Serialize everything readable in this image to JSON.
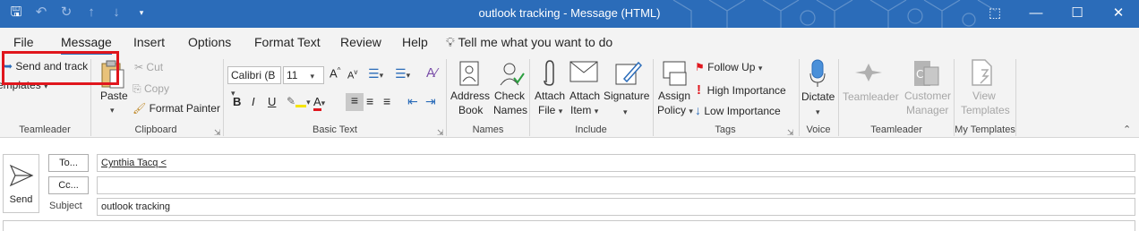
{
  "window": {
    "title": "outlook tracking  -  Message (HTML)",
    "accent": "#2b6cb9"
  },
  "menu": {
    "tabs": [
      "File",
      "Message",
      "Insert",
      "Options",
      "Format Text",
      "Review",
      "Help"
    ],
    "tell_me": "Tell me what you want to do"
  },
  "ribbon": {
    "teamleader": {
      "send_and_track": "Send and track",
      "templates": "Templates",
      "group": "Teamleader"
    },
    "clipboard": {
      "paste": "Paste",
      "cut": "Cut",
      "copy": "Copy",
      "format_painter": "Format Painter",
      "group": "Clipboard"
    },
    "basic_text": {
      "font": "Calibri (B",
      "size": "11",
      "group": "Basic Text"
    },
    "names": {
      "address_book_1": "Address",
      "address_book_2": "Book",
      "check_names_1": "Check",
      "check_names_2": "Names",
      "group": "Names"
    },
    "include": {
      "attach_file_1": "Attach",
      "attach_file_2": "File",
      "attach_item_1": "Attach",
      "attach_item_2": "Item",
      "signature": "Signature",
      "group": "Include"
    },
    "tags": {
      "assign_policy_1": "Assign",
      "assign_policy_2": "Policy",
      "follow_up": "Follow Up",
      "high_importance": "High Importance",
      "low_importance": "Low Importance",
      "group": "Tags"
    },
    "voice": {
      "dictate": "Dictate",
      "group": "Voice"
    },
    "teamleader2": {
      "teamleader": "Teamleader",
      "customer_1": "Customer",
      "customer_2": "Manager",
      "group": "Teamleader"
    },
    "my_templates": {
      "view_1": "View",
      "view_2": "Templates",
      "group": "My Templates"
    }
  },
  "compose": {
    "send": "Send",
    "to_button": "To...",
    "cc_button": "Cc...",
    "subject_label": "Subject",
    "to_value": "Cynthia Tacq < ",
    "cc_value": "",
    "subject_value": "outlook tracking"
  }
}
